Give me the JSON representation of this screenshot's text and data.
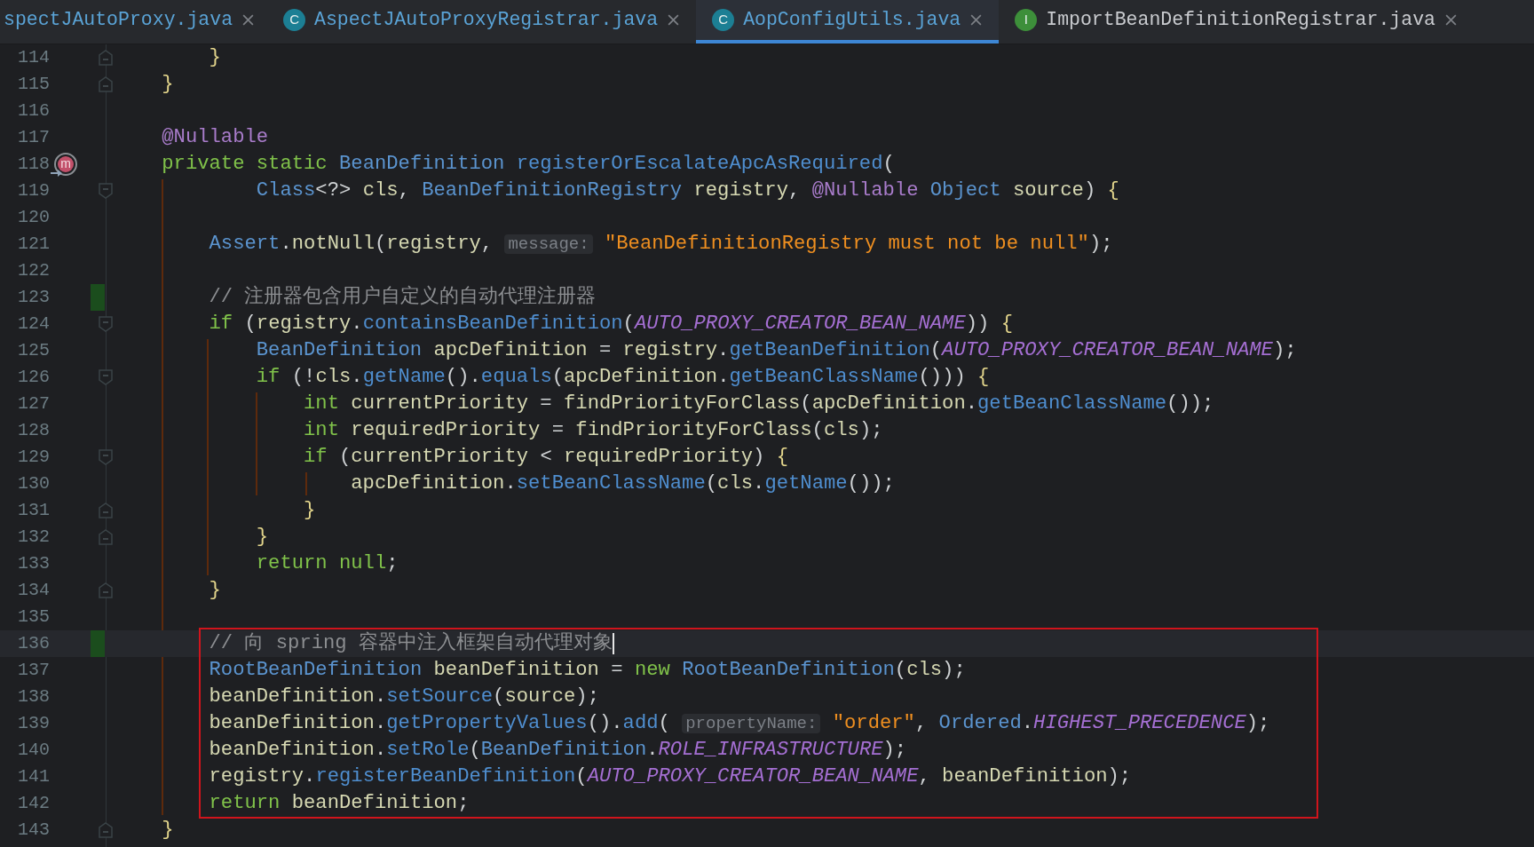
{
  "tabs": [
    {
      "label": "spectJAutoProxy.java",
      "modified": true,
      "selected": false
    },
    {
      "label": "AspectJAutoProxyRegistrar.java",
      "icon_letter": "C",
      "color": "#1c7f94",
      "modified": true,
      "selected": false
    },
    {
      "label": "AopConfigUtils.java",
      "icon_letter": "C",
      "color": "#1c7f94",
      "modified": true,
      "selected": true
    },
    {
      "label": "ImportBeanDefinitionRegistrar.java",
      "icon_letter": "I",
      "color": "#3d8f3a",
      "modified": false,
      "selected": false
    }
  ],
  "lines": [
    {
      "number": "114",
      "fold_close": true,
      "tokens": [
        {
          "kind": "brace",
          "text": "        }"
        }
      ]
    },
    {
      "number": "115",
      "fold_close": true,
      "tokens": [
        {
          "kind": "brace",
          "text": "    }"
        }
      ]
    },
    {
      "number": "116"
    },
    {
      "number": "117",
      "tokens": [
        {
          "kind": "ann",
          "text": "    @Nullable"
        }
      ]
    },
    {
      "number": "118",
      "gutter_letter": "m",
      "tokens": [
        {
          "kind": "kw",
          "text": "    private static "
        },
        {
          "kind": "type",
          "text": "BeanDefinition"
        },
        {
          "kind": "fn",
          "text": " registerOrEscalateApcAsRequired"
        },
        {
          "kind": "p",
          "text": "("
        }
      ]
    },
    {
      "number": "119",
      "fold_open": true,
      "tokens": [
        {
          "kind": "type",
          "text": "            Class"
        },
        {
          "kind": "p",
          "text": "<?> "
        },
        {
          "kind": "id",
          "text": "cls"
        },
        {
          "kind": "p",
          "text": ", "
        },
        {
          "kind": "type",
          "text": "BeanDefinitionRegistry"
        },
        {
          "kind": "id",
          "text": " registry"
        },
        {
          "kind": "p",
          "text": ", "
        },
        {
          "kind": "ann",
          "text": "@Nullable "
        },
        {
          "kind": "type",
          "text": "Object"
        },
        {
          "kind": "id",
          "text": " source"
        },
        {
          "kind": "p",
          "text": ") "
        },
        {
          "kind": "brace",
          "text": "{"
        }
      ]
    },
    {
      "number": "120"
    },
    {
      "number": "121",
      "tokens": [
        {
          "kind": "type",
          "text": "        Assert"
        },
        {
          "kind": "p",
          "text": "."
        },
        {
          "kind": "id",
          "text": "notNull"
        },
        {
          "kind": "p",
          "text": "("
        },
        {
          "kind": "id",
          "text": "registry"
        },
        {
          "kind": "p",
          "text": ", "
        },
        {
          "kind": "hint",
          "text": "message:"
        },
        {
          "kind": "str",
          "text": " \"BeanDefinitionRegistry must not be null\""
        },
        {
          "kind": "p",
          "text": ");"
        }
      ]
    },
    {
      "number": "122"
    },
    {
      "number": "123",
      "changed": true,
      "tokens": [
        {
          "kind": "cmt",
          "text": "        // 注册器包含用户自定义的自动代理注册器"
        }
      ]
    },
    {
      "number": "124",
      "fold_open": true,
      "tokens": [
        {
          "kind": "kw",
          "text": "        if"
        },
        {
          "kind": "p",
          "text": " ("
        },
        {
          "kind": "id",
          "text": "registry"
        },
        {
          "kind": "p",
          "text": "."
        },
        {
          "kind": "fn",
          "text": "containsBeanDefinition"
        },
        {
          "kind": "p",
          "text": "("
        },
        {
          "kind": "const",
          "text": "AUTO_PROXY_CREATOR_BEAN_NAME"
        },
        {
          "kind": "p",
          "text": ")) "
        },
        {
          "kind": "brace",
          "text": "{"
        }
      ]
    },
    {
      "number": "125",
      "tokens": [
        {
          "kind": "type",
          "text": "            BeanDefinition"
        },
        {
          "kind": "id",
          "text": " apcDefinition"
        },
        {
          "kind": "p",
          "text": " = "
        },
        {
          "kind": "id",
          "text": "registry"
        },
        {
          "kind": "p",
          "text": "."
        },
        {
          "kind": "fn",
          "text": "getBeanDefinition"
        },
        {
          "kind": "p",
          "text": "("
        },
        {
          "kind": "const",
          "text": "AUTO_PROXY_CREATOR_BEAN_NAME"
        },
        {
          "kind": "p",
          "text": ");"
        }
      ]
    },
    {
      "number": "126",
      "fold_open": true,
      "tokens": [
        {
          "kind": "kw",
          "text": "            if"
        },
        {
          "kind": "p",
          "text": " (!"
        },
        {
          "kind": "id",
          "text": "cls"
        },
        {
          "kind": "p",
          "text": "."
        },
        {
          "kind": "fn",
          "text": "getName"
        },
        {
          "kind": "p",
          "text": "()."
        },
        {
          "kind": "fn",
          "text": "equals"
        },
        {
          "kind": "p",
          "text": "("
        },
        {
          "kind": "id",
          "text": "apcDefinition"
        },
        {
          "kind": "p",
          "text": "."
        },
        {
          "kind": "fn",
          "text": "getBeanClassName"
        },
        {
          "kind": "p",
          "text": "())) "
        },
        {
          "kind": "brace",
          "text": "{"
        }
      ]
    },
    {
      "number": "127",
      "tokens": [
        {
          "kind": "kw",
          "text": "                int"
        },
        {
          "kind": "id",
          "text": " currentPriority"
        },
        {
          "kind": "p",
          "text": " = "
        },
        {
          "kind": "id",
          "text": "findPriorityForClass"
        },
        {
          "kind": "p",
          "text": "("
        },
        {
          "kind": "id",
          "text": "apcDefinition"
        },
        {
          "kind": "p",
          "text": "."
        },
        {
          "kind": "fn",
          "text": "getBeanClassName"
        },
        {
          "kind": "p",
          "text": "());"
        }
      ]
    },
    {
      "number": "128",
      "tokens": [
        {
          "kind": "kw",
          "text": "                int"
        },
        {
          "kind": "id",
          "text": " requiredPriority"
        },
        {
          "kind": "p",
          "text": " = "
        },
        {
          "kind": "id",
          "text": "findPriorityForClass"
        },
        {
          "kind": "p",
          "text": "("
        },
        {
          "kind": "id",
          "text": "cls"
        },
        {
          "kind": "p",
          "text": ");"
        }
      ]
    },
    {
      "number": "129",
      "fold_open": true,
      "tokens": [
        {
          "kind": "kw",
          "text": "                if"
        },
        {
          "kind": "p",
          "text": " ("
        },
        {
          "kind": "id",
          "text": "currentPriority"
        },
        {
          "kind": "p",
          "text": " < "
        },
        {
          "kind": "id",
          "text": "requiredPriority"
        },
        {
          "kind": "p",
          "text": ") "
        },
        {
          "kind": "brace",
          "text": "{"
        }
      ]
    },
    {
      "number": "130",
      "tokens": [
        {
          "kind": "id",
          "text": "                    apcDefinition"
        },
        {
          "kind": "p",
          "text": "."
        },
        {
          "kind": "fn",
          "text": "setBeanClassName"
        },
        {
          "kind": "p",
          "text": "("
        },
        {
          "kind": "id",
          "text": "cls"
        },
        {
          "kind": "p",
          "text": "."
        },
        {
          "kind": "fn",
          "text": "getName"
        },
        {
          "kind": "p",
          "text": "());"
        }
      ]
    },
    {
      "number": "131",
      "fold_close": true,
      "tokens": [
        {
          "kind": "brace",
          "text": "                }"
        }
      ]
    },
    {
      "number": "132",
      "fold_close": true,
      "tokens": [
        {
          "kind": "brace",
          "text": "            }"
        }
      ]
    },
    {
      "number": "133",
      "tokens": [
        {
          "kind": "kw",
          "text": "            return null"
        },
        {
          "kind": "p",
          "text": ";"
        }
      ]
    },
    {
      "number": "134",
      "fold_close": true,
      "tokens": [
        {
          "kind": "brace",
          "text": "        }"
        }
      ]
    },
    {
      "number": "135"
    },
    {
      "number": "136",
      "changed": true,
      "current": true,
      "boxed": true,
      "tokens": [
        {
          "kind": "cmt",
          "text": "        // 向 spring 容器中注入框架自动代理对象"
        }
      ]
    },
    {
      "number": "137",
      "boxed": true,
      "tokens": [
        {
          "kind": "type",
          "text": "        RootBeanDefinition"
        },
        {
          "kind": "id",
          "text": " beanDefinition"
        },
        {
          "kind": "p",
          "text": " = "
        },
        {
          "kind": "kw",
          "text": "new"
        },
        {
          "kind": "type",
          "text": " RootBeanDefinition"
        },
        {
          "kind": "p",
          "text": "("
        },
        {
          "kind": "id",
          "text": "cls"
        },
        {
          "kind": "p",
          "text": ");"
        }
      ]
    },
    {
      "number": "138",
      "boxed": true,
      "tokens": [
        {
          "kind": "id",
          "text": "        beanDefinition"
        },
        {
          "kind": "p",
          "text": "."
        },
        {
          "kind": "fn",
          "text": "setSource"
        },
        {
          "kind": "p",
          "text": "("
        },
        {
          "kind": "id",
          "text": "source"
        },
        {
          "kind": "p",
          "text": ");"
        }
      ]
    },
    {
      "number": "139",
      "boxed": true,
      "tokens": [
        {
          "kind": "id",
          "text": "        beanDefinition"
        },
        {
          "kind": "p",
          "text": "."
        },
        {
          "kind": "fn",
          "text": "getPropertyValues"
        },
        {
          "kind": "p",
          "text": "()."
        },
        {
          "kind": "fn",
          "text": "add"
        },
        {
          "kind": "p",
          "text": "( "
        },
        {
          "kind": "hint",
          "text": "propertyName:"
        },
        {
          "kind": "str",
          "text": " \"order\""
        },
        {
          "kind": "p",
          "text": ", "
        },
        {
          "kind": "type",
          "text": "Ordered"
        },
        {
          "kind": "p",
          "text": "."
        },
        {
          "kind": "const",
          "text": "HIGHEST_PRECEDENCE"
        },
        {
          "kind": "p",
          "text": ");"
        }
      ]
    },
    {
      "number": "140",
      "boxed": true,
      "tokens": [
        {
          "kind": "id",
          "text": "        beanDefinition"
        },
        {
          "kind": "p",
          "text": "."
        },
        {
          "kind": "fn",
          "text": "setRole"
        },
        {
          "kind": "p",
          "text": "("
        },
        {
          "kind": "type",
          "text": "BeanDefinition"
        },
        {
          "kind": "p",
          "text": "."
        },
        {
          "kind": "const",
          "text": "ROLE_INFRASTRUCTURE"
        },
        {
          "kind": "p",
          "text": ");"
        }
      ]
    },
    {
      "number": "141",
      "boxed": true,
      "tokens": [
        {
          "kind": "id",
          "text": "        registry"
        },
        {
          "kind": "p",
          "text": "."
        },
        {
          "kind": "fn",
          "text": "registerBeanDefinition"
        },
        {
          "kind": "p",
          "text": "("
        },
        {
          "kind": "const",
          "text": "AUTO_PROXY_CREATOR_BEAN_NAME"
        },
        {
          "kind": "p",
          "text": ", "
        },
        {
          "kind": "id",
          "text": "beanDefinition"
        },
        {
          "kind": "p",
          "text": ");"
        }
      ]
    },
    {
      "number": "142",
      "boxed": true,
      "tokens": [
        {
          "kind": "kw",
          "text": "        return"
        },
        {
          "kind": "id",
          "text": " beanDefinition"
        },
        {
          "kind": "p",
          "text": ";"
        }
      ]
    },
    {
      "number": "143",
      "fold_close": true,
      "tokens": [
        {
          "kind": "brace",
          "text": "    }"
        }
      ]
    }
  ]
}
